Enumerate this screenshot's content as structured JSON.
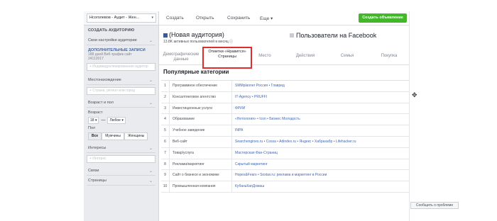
{
  "left_panel": {
    "account_select": "Нсоголевов - Аудит - Жен...",
    "create_audience_header": "СОЗДАТЬ АУДИТОРИЮ",
    "own_settings": "Свои настройки аудитории",
    "extra_records_title": "ДОПОЛНИТЕЛЬНЫЕ ЗАПИСИ",
    "extra_records_line1": "188 дней Веб-трафик сайт",
    "extra_records_line2": "24112017",
    "custom_audience_placeholder": "+ Индивидуализированная аудитор",
    "location_label": "Местонахождение",
    "location_placeholder": "+ Страна, регион или город",
    "age_gender_label": "Возраст и пол",
    "age_label": "Возраст",
    "age_from": "18 ▾",
    "age_dash": "—",
    "age_to": "Любое ▾",
    "gender_label": "Пол",
    "gender_options": [
      "Все",
      "Мужчины",
      "Женщины"
    ],
    "interests_label": "Интересы",
    "interests_placeholder": "+ Интерес",
    "connections_label": "Связи",
    "pages_label": "Страницы"
  },
  "toolbar": {
    "create": "Создать",
    "open": "Открыть",
    "save": "Сохранить",
    "more": "Еще ▾",
    "create_ad": "Создать объявление"
  },
  "header": {
    "audience_title": "(Новая аудитория)",
    "audience_sub": "13.8K активных пользователей в месяц ⓘ",
    "facebook_title": "Пользователи на Facebook"
  },
  "tabs": {
    "demographics": "Демографические данные",
    "likes": "Отметки «Нравится» Страницы",
    "location": "Место",
    "activity": "Действия",
    "household": "Семья",
    "purchase": "Покупка"
  },
  "popular_categories_title": "Популярные категории",
  "categories": [
    {
      "n": "1",
      "category": "Программное обеспечение",
      "pages": "SMMplanner Россия  •  Главред"
    },
    {
      "n": "2",
      "category": "Консалтинговое агентство",
      "pages": "IT-Agency  •  PRUFFI"
    },
    {
      "n": "3",
      "category": "Инвестиционные услуги",
      "pages": "ФРИИ"
    },
    {
      "n": "4",
      "category": "Образование",
      "pages": "«Нетология»  •  Icon  •  Бизнес Молодость"
    },
    {
      "n": "5",
      "category": "Учебное заведение",
      "pages": "INPA"
    },
    {
      "n": "6",
      "category": "Веб-сайт",
      "pages": "Searchengines.ru  •  Cossa  •  Adindex.ru  •  Яндекс  •  Хабрахабр  •  Lifehacker.ru"
    },
    {
      "n": "7",
      "category": "Товар/услуга",
      "pages": "Мастерская Фан-Страниц"
    },
    {
      "n": "8",
      "category": "Реклама/маркетинг",
      "pages": "Скрытый маркетинг"
    },
    {
      "n": "9",
      "category": "Сайт о бизнесе и экономике",
      "pages": "Hopes&Fears  •  Sostav.ru: реклама и маркетинг в России"
    },
    {
      "n": "10",
      "category": "Промышленная компания",
      "pages": "КубаньКапДомаш"
    }
  ],
  "report_problem": "Сообщить о проблеме",
  "colors": {
    "audience_square": "#3b5998",
    "facebook_square": "#c8ccd2",
    "highlight_box": "#e02c2c",
    "create_ad_button": "#42b72a",
    "link_blue": "#4267b2"
  },
  "icons": [
    "move-cursor-icon",
    "chevron-down-icon",
    "info-icon"
  ]
}
